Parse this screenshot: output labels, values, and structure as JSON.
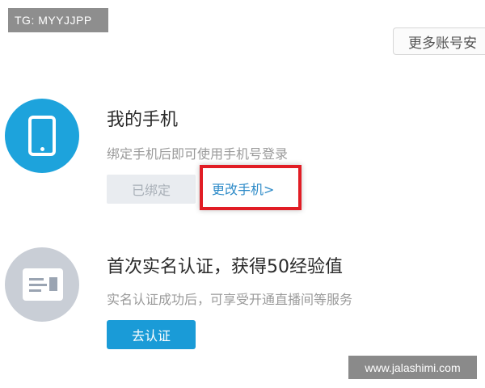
{
  "watermark_top": "TG: MYYJJPP",
  "more_button": "更多账号安",
  "phone_section": {
    "icon": "phone-icon",
    "title": "我的手机",
    "subtitle": "绑定手机后即可使用手机号登录",
    "bound_button": "已绑定",
    "change_link": "更改手机>"
  },
  "verify_section": {
    "icon": "id-card-icon",
    "title": "首次实名认证，获得50经验值",
    "subtitle": "实名认证成功后，可享受开通直播间等服务",
    "verify_button": "去认证"
  },
  "watermark_bottom": "www.jalashimi.com",
  "colors": {
    "accent_blue": "#1a9bd7",
    "highlight_red": "#e11d25",
    "icon_gray": "#c9ced6"
  }
}
